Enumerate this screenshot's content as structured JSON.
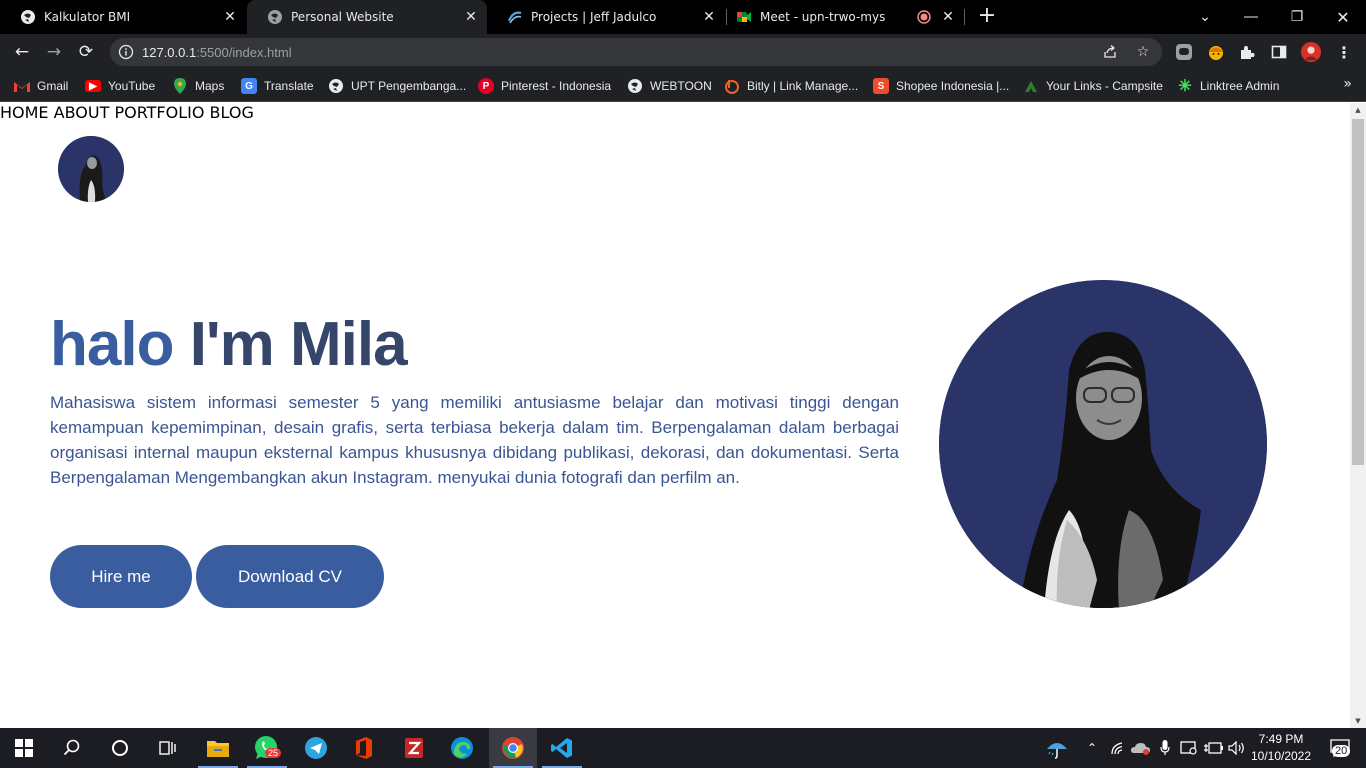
{
  "browser": {
    "tabs": [
      {
        "title": "Kalkulator BMI",
        "favicon": "globe-icon",
        "active": false
      },
      {
        "title": "Personal Website",
        "favicon": "globe-icon",
        "active": true
      },
      {
        "title": "Projects | Jeff Jadulco",
        "favicon": "swirl-icon",
        "active": false
      },
      {
        "title": "Meet - upn-trwo-mys",
        "favicon": "meet-icon",
        "active": false
      }
    ],
    "url_host": "127.0.0.1",
    "url_rest": ":5500/index.html",
    "bookmarks": [
      {
        "label": "Gmail",
        "icon": "gmail-icon",
        "color": "#ea4335"
      },
      {
        "label": "YouTube",
        "icon": "youtube-icon",
        "color": "#ff0000"
      },
      {
        "label": "Maps",
        "icon": "maps-icon",
        "color": "#34a853"
      },
      {
        "label": "Translate",
        "icon": "translate-icon",
        "color": "#4285f4"
      },
      {
        "label": "UPT Pengembanga...",
        "icon": "globe-icon",
        "color": "#e8eaed"
      },
      {
        "label": "Pinterest - Indonesia",
        "icon": "pinterest-icon",
        "color": "#e60023"
      },
      {
        "label": "WEBTOON",
        "icon": "globe-icon",
        "color": "#e8eaed"
      },
      {
        "label": "Bitly | Link Manage...",
        "icon": "bitly-icon",
        "color": "#ee6123"
      },
      {
        "label": "Shopee Indonesia |...",
        "icon": "shopee-icon",
        "color": "#ee4d2d"
      },
      {
        "label": "Your Links - Campsite",
        "icon": "campsite-icon",
        "color": "#2e7d32"
      },
      {
        "label": "Linktree Admin",
        "icon": "linktree-icon",
        "color": "#43e660"
      }
    ]
  },
  "page": {
    "nav": [
      "HOME",
      "ABOUT",
      "PORTFOLIO",
      "BLOG"
    ],
    "hero": {
      "greeting": "halo",
      "name": "I'm Mila",
      "description": "Mahasiswa sistem informasi semester 5 yang memiliki antusiasme belajar dan motivasi tinggi dengan kemampuan kepemimpinan, desain grafis, serta terbiasa bekerja dalam tim. Berpengalaman dalam berbagai organisasi internal maupun eksternal kampus khususnya dibidang publikasi, dekorasi, dan dokumentasi. Serta Berpengalaman Mengembangkan akun Instagram. menyukai dunia fotografi dan perfilm an.",
      "btn_hire": "Hire me",
      "btn_cv": "Download CV"
    },
    "colors": {
      "accent": "#3a5da0",
      "dark": "#36466b",
      "photo_bg": "#2b3468"
    }
  },
  "taskbar": {
    "whatsapp_badge": "25",
    "time": "7:49 PM",
    "date": "10/10/2022",
    "notifications": "20"
  }
}
